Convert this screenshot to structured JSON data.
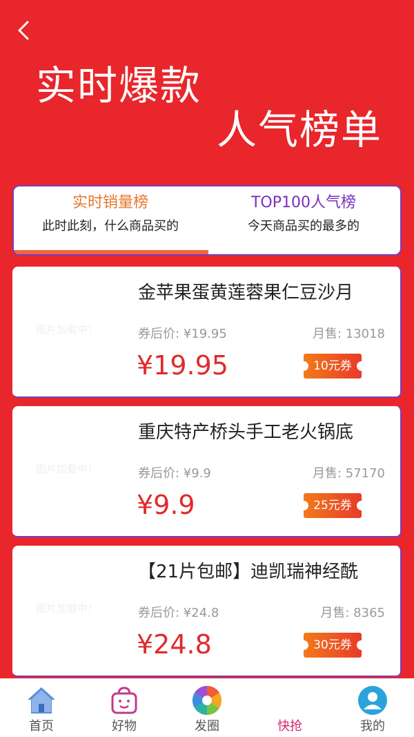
{
  "header": {
    "back_icon": "chevron-left-icon",
    "hero_line1": "实时爆款",
    "hero_line2": "人气榜单"
  },
  "tabs": [
    {
      "title": "实时销量榜",
      "subtitle": "此时此刻，什么商品买的",
      "active": true
    },
    {
      "title": "TOP100人气榜",
      "subtitle": "今天商品买的最多的",
      "active": false
    }
  ],
  "products": [
    {
      "thumb_placeholder": "图片加载中！",
      "name": "金苹果蛋黄莲蓉果仁豆沙月",
      "coupon_price_label": "券后价: ¥19.95",
      "monthly_sales": "月售: 13018",
      "price": "¥19.95",
      "coupon": "10元券"
    },
    {
      "thumb_placeholder": "图片加载中！",
      "name": "重庆特产桥头手工老火锅底",
      "coupon_price_label": "券后价: ¥9.9",
      "monthly_sales": "月售: 57170",
      "price": "¥9.9",
      "coupon": "25元券"
    },
    {
      "thumb_placeholder": "图片加载中！",
      "name": "【21片包邮】迪凯瑞神经酰",
      "coupon_price_label": "券后价: ¥24.8",
      "monthly_sales": "月售: 8365",
      "price": "¥24.8",
      "coupon": "30元券"
    }
  ],
  "bottom_nav": [
    {
      "label": "首页",
      "icon": "home-icon",
      "active": false
    },
    {
      "label": "好物",
      "icon": "basket-icon",
      "active": false
    },
    {
      "label": "发圈",
      "icon": "aperture-icon",
      "active": false
    },
    {
      "label": "快抢",
      "icon": "",
      "active": true
    },
    {
      "label": "我的",
      "icon": "user-icon",
      "active": false
    }
  ],
  "colors": {
    "background": "#e8262b",
    "price": "#e02a2a",
    "tab_active": "#e8762b",
    "tab_other": "#7a2fbf",
    "nav_active": "#d2266a"
  }
}
